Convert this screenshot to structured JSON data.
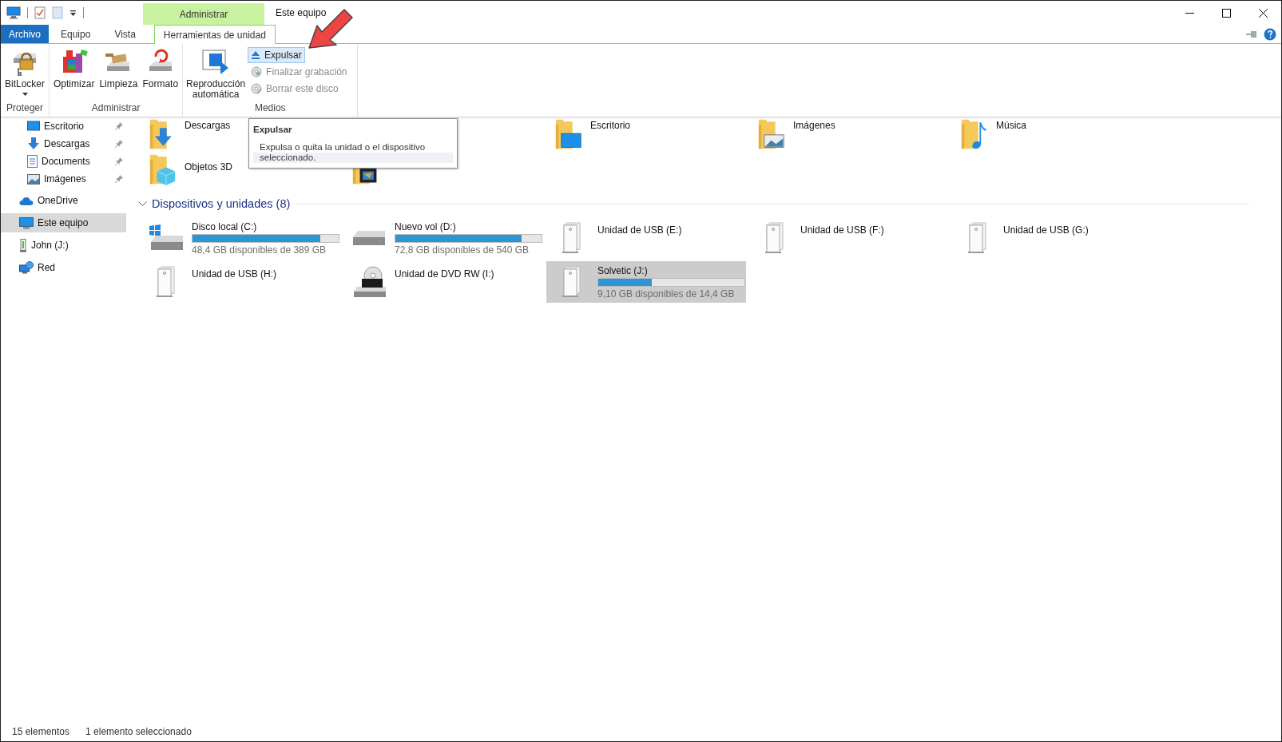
{
  "window": {
    "title": "Este equipo",
    "context_header": "Administrar"
  },
  "tabs": [
    {
      "label": "Archivo",
      "kind": "file",
      "selected": false
    },
    {
      "label": "Equipo",
      "kind": "tab",
      "selected": false
    },
    {
      "label": "Vista",
      "kind": "tab",
      "selected": false
    },
    {
      "label": "Herramientas de unidad",
      "kind": "contextual",
      "selected": true
    }
  ],
  "ribbon": {
    "groups": [
      {
        "name": "Proteger",
        "large_buttons": [
          {
            "label": "BitLocker",
            "kind": "bitlocker",
            "dropdown": true
          }
        ]
      },
      {
        "name": "Administrar",
        "large_buttons": [
          {
            "label": "Optimizar",
            "kind": "optimize",
            "dropdown": false
          },
          {
            "label": "Limpieza",
            "kind": "cleanup",
            "dropdown": false
          },
          {
            "label": "Formato",
            "kind": "format",
            "dropdown": false
          }
        ]
      },
      {
        "name": "Medios",
        "large_buttons": [
          {
            "label": "Reproducción automática",
            "kind": "autoplay",
            "dropdown": false
          }
        ],
        "small_buttons": [
          {
            "label": "Expulsar",
            "kind": "eject",
            "highlighted": true,
            "disabled": false
          },
          {
            "label": "Finalizar grabación",
            "kind": "burn",
            "highlighted": false,
            "disabled": true
          },
          {
            "label": "Borrar este disco",
            "kind": "erase",
            "highlighted": false,
            "disabled": true
          }
        ]
      }
    ]
  },
  "tooltip": {
    "title": "Expulsar",
    "text": "Expulsa o quita la unidad o el dispositivo seleccionado."
  },
  "navigation": {
    "quick_access": [
      {
        "label": "Escritorio",
        "kind": "desktop",
        "pinned": true
      },
      {
        "label": "Descargas",
        "kind": "downloads",
        "pinned": true
      },
      {
        "label": "Documents",
        "kind": "documents",
        "pinned": true
      },
      {
        "label": "Imágenes",
        "kind": "pictures",
        "pinned": true
      }
    ],
    "items": [
      {
        "label": "OneDrive",
        "kind": "cloud",
        "selected": false
      },
      {
        "label": "Este equipo",
        "kind": "computer",
        "selected": true
      },
      {
        "label": "John (J:)",
        "kind": "usb",
        "selected": false
      },
      {
        "label": "Red",
        "kind": "network",
        "selected": false
      }
    ]
  },
  "folders": [
    {
      "name": "Descargas",
      "kind": "downloads"
    },
    {
      "name": "Escritorio",
      "kind": "desktop"
    },
    {
      "name": "Imágenes",
      "kind": "pictures"
    },
    {
      "name": "Música",
      "kind": "music"
    },
    {
      "name": "Objetos 3D",
      "kind": "objects3d"
    },
    {
      "kind": "videos"
    }
  ],
  "section": {
    "title": "Dispositivos y unidades (8)",
    "expanded": true
  },
  "drives": [
    {
      "name": "Disco local (C:)",
      "kind": "system",
      "level": 0.876,
      "space": "48,4 GB disponibles de 389 GB",
      "selected": false
    },
    {
      "name": "Nuevo vol (D:)",
      "kind": "hdd",
      "level": 0.865,
      "space": "72,8 GB disponibles de 540 GB",
      "selected": false
    },
    {
      "name": "Unidad de USB (E:)",
      "kind": "usb",
      "selected": false
    },
    {
      "name": "Unidad de USB (F:)",
      "kind": "usb",
      "selected": false
    },
    {
      "name": "Unidad de USB (G:)",
      "kind": "usb",
      "selected": false
    },
    {
      "name": "Unidad de USB (H:)",
      "kind": "usb",
      "selected": false
    },
    {
      "name": "Unidad de DVD RW (I:)",
      "kind": "dvd",
      "selected": false
    },
    {
      "name": "Solvetic (J:)",
      "kind": "usb",
      "level": 0.368,
      "space": "9,10 GB disponibles de 14,4 GB",
      "selected": true
    }
  ],
  "status_bar": {
    "count": "15 elementos",
    "selection": "1 elemento seleccionado"
  }
}
